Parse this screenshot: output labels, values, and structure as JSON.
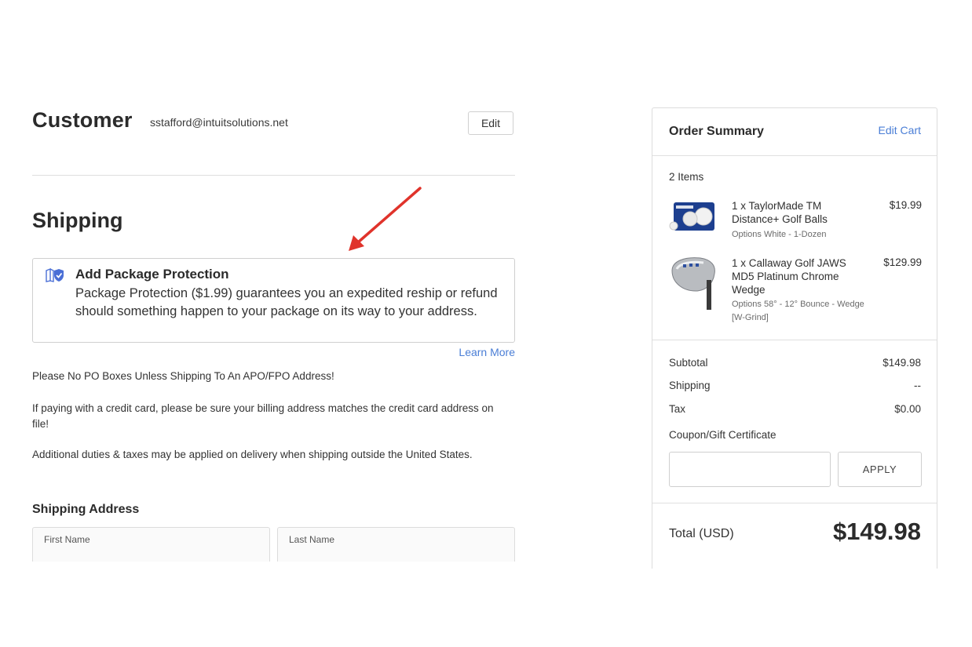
{
  "customer": {
    "title": "Customer",
    "email": "sstafford@intuitsolutions.net",
    "edit_label": "Edit"
  },
  "shipping": {
    "title": "Shipping",
    "protection": {
      "icon": "shield-icon",
      "heading": "Add Package Protection",
      "description": "Package Protection ($1.99) guarantees you an expedited reship or refund should something happen to your package on its way to your address.",
      "learn_more": "Learn More"
    },
    "notes": [
      "Please No PO Boxes Unless Shipping To An APO/FPO Address!",
      "If paying with a credit card, please be sure your billing address matches the credit card address on file!",
      "Additional duties & taxes may be applied on delivery when shipping outside the United States."
    ],
    "address": {
      "title": "Shipping Address",
      "first_name_label": "First Name",
      "last_name_label": "Last Name"
    }
  },
  "summary": {
    "title": "Order Summary",
    "edit_cart": "Edit Cart",
    "items_count": "2 Items",
    "items": [
      {
        "name": "1 x TaylorMade TM Distance+ Golf Balls",
        "price": "$19.99",
        "options": "Options White - 1-Dozen"
      },
      {
        "name": "1 x Callaway Golf JAWS MD5 Platinum Chrome Wedge",
        "price": "$129.99",
        "options": "Options 58° - 12° Bounce - Wedge [W-Grind]"
      }
    ],
    "subtotal_label": "Subtotal",
    "subtotal": "$149.98",
    "shipping_label": "Shipping",
    "shipping": "--",
    "tax_label": "Tax",
    "tax": "$0.00",
    "coupon_label": "Coupon/Gift Certificate",
    "apply_label": "APPLY",
    "total_label": "Total (USD)",
    "total": "$149.98"
  },
  "colors": {
    "link": "#4a7ed6",
    "annotation_arrow": "#e0332b"
  }
}
